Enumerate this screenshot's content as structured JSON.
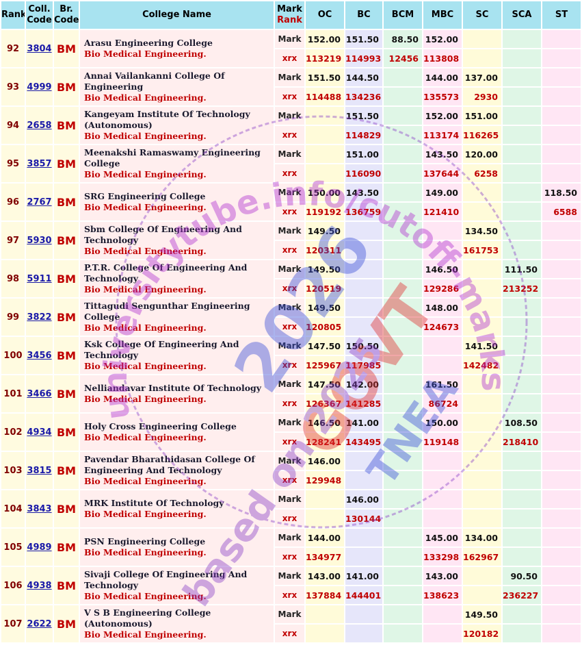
{
  "headers": {
    "rank": "Rank",
    "coll_code": "Coll. Code",
    "br_code": "Br. Code",
    "college_name": "College Name",
    "mark_word": "Mark",
    "rank_word": "Rank",
    "oc": "OC",
    "bc": "BC",
    "bcm": "BCM",
    "mbc": "MBC",
    "sc": "SC",
    "sca": "SCA",
    "st": "ST"
  },
  "labels": {
    "mark": "Mark",
    "rank": "xrx"
  },
  "watermark": {
    "line1": "universitytube.info/cutoff-marks",
    "line2": "2026",
    "line3": "GOVT",
    "line4": "TNEA",
    "line5": "based on 2025"
  },
  "colors": {
    "header_bg": "#a8e3f0",
    "rank_text": "#800000",
    "branch_text": "#c00000",
    "link_text": "#1a1aa8"
  },
  "rows": [
    {
      "rank": "92",
      "code": "3804",
      "br": "BM",
      "name": "Arasu Engineering College",
      "branch": "Bio Medical Engineering.",
      "marks": {
        "oc": "152.00",
        "bc": "151.50",
        "bcm": "88.50",
        "mbc": "152.00",
        "sc": "",
        "sca": "",
        "st": ""
      },
      "ranks": {
        "oc": "113219",
        "bc": "114993",
        "bcm": "12456",
        "mbc": "113808",
        "sc": "",
        "sca": "",
        "st": ""
      }
    },
    {
      "rank": "93",
      "code": "4999",
      "br": "BM",
      "name": "Annai Vailankanni College Of Engineering",
      "branch": "Bio Medical Engineering.",
      "marks": {
        "oc": "151.50",
        "bc": "144.50",
        "bcm": "",
        "mbc": "144.00",
        "sc": "137.00",
        "sca": "",
        "st": ""
      },
      "ranks": {
        "oc": "114488",
        "bc": "134236",
        "bcm": "",
        "mbc": "135573",
        "sc": "2930",
        "sca": "",
        "st": ""
      }
    },
    {
      "rank": "94",
      "code": "2658",
      "br": "BM",
      "name": "Kangeyam Institute Of Technology (Autonomous)",
      "branch": "Bio Medical Engineering.",
      "marks": {
        "oc": "",
        "bc": "151.50",
        "bcm": "",
        "mbc": "152.00",
        "sc": "151.00",
        "sca": "",
        "st": ""
      },
      "ranks": {
        "oc": "",
        "bc": "114829",
        "bcm": "",
        "mbc": "113174",
        "sc": "116265",
        "sca": "",
        "st": ""
      }
    },
    {
      "rank": "95",
      "code": "3857",
      "br": "BM",
      "name": "Meenakshi Ramaswamy Engineering College",
      "branch": "Bio Medical Engineering.",
      "marks": {
        "oc": "",
        "bc": "151.00",
        "bcm": "",
        "mbc": "143.50",
        "sc": "120.00",
        "sca": "",
        "st": ""
      },
      "ranks": {
        "oc": "",
        "bc": "116090",
        "bcm": "",
        "mbc": "137644",
        "sc": "6258",
        "sca": "",
        "st": ""
      }
    },
    {
      "rank": "96",
      "code": "2767",
      "br": "BM",
      "name": "SRG Engineering College",
      "branch": "Bio Medical Engineering.",
      "marks": {
        "oc": "150.00",
        "bc": "143.50",
        "bcm": "",
        "mbc": "149.00",
        "sc": "",
        "sca": "",
        "st": "118.50"
      },
      "ranks": {
        "oc": "119192",
        "bc": "136759",
        "bcm": "",
        "mbc": "121410",
        "sc": "",
        "sca": "",
        "st": "6588"
      }
    },
    {
      "rank": "97",
      "code": "5930",
      "br": "BM",
      "name": "Sbm College Of Engineering And Technology",
      "branch": "Bio Medical Engineering.",
      "marks": {
        "oc": "149.50",
        "bc": "",
        "bcm": "",
        "mbc": "",
        "sc": "134.50",
        "sca": "",
        "st": ""
      },
      "ranks": {
        "oc": "120311",
        "bc": "",
        "bcm": "",
        "mbc": "",
        "sc": "161753",
        "sca": "",
        "st": ""
      }
    },
    {
      "rank": "98",
      "code": "5911",
      "br": "BM",
      "name": "P.T.R. College Of Engineering And Technology",
      "branch": "Bio Medical Engineering.",
      "marks": {
        "oc": "149.50",
        "bc": "",
        "bcm": "",
        "mbc": "146.50",
        "sc": "",
        "sca": "111.50",
        "st": ""
      },
      "ranks": {
        "oc": "120519",
        "bc": "",
        "bcm": "",
        "mbc": "129286",
        "sc": "",
        "sca": "213252",
        "st": ""
      }
    },
    {
      "rank": "99",
      "code": "3822",
      "br": "BM",
      "name": "Tittagudi Sengunthar Engineering College",
      "branch": "Bio Medical Engineering.",
      "marks": {
        "oc": "149.50",
        "bc": "",
        "bcm": "",
        "mbc": "148.00",
        "sc": "",
        "sca": "",
        "st": ""
      },
      "ranks": {
        "oc": "120805",
        "bc": "",
        "bcm": "",
        "mbc": "124673",
        "sc": "",
        "sca": "",
        "st": ""
      }
    },
    {
      "rank": "100",
      "code": "3456",
      "br": "BM",
      "name": "Ksk College Of Engineering And Technology",
      "branch": "Bio Medical Engineering.",
      "marks": {
        "oc": "147.50",
        "bc": "150.50",
        "bcm": "",
        "mbc": "",
        "sc": "141.50",
        "sca": "",
        "st": ""
      },
      "ranks": {
        "oc": "125967",
        "bc": "117985",
        "bcm": "",
        "mbc": "",
        "sc": "142482",
        "sca": "",
        "st": ""
      }
    },
    {
      "rank": "101",
      "code": "3466",
      "br": "BM",
      "name": "Nelliandavar Institute Of Technology",
      "branch": "Bio Medical Engineering.",
      "marks": {
        "oc": "147.50",
        "bc": "142.00",
        "bcm": "",
        "mbc": "161.50",
        "sc": "",
        "sca": "",
        "st": ""
      },
      "ranks": {
        "oc": "126367",
        "bc": "141285",
        "bcm": "",
        "mbc": "86724",
        "sc": "",
        "sca": "",
        "st": ""
      }
    },
    {
      "rank": "102",
      "code": "4934",
      "br": "BM",
      "name": "Holy Cross Engineering College",
      "branch": "Bio Medical Engineering.",
      "marks": {
        "oc": "146.50",
        "bc": "141.00",
        "bcm": "",
        "mbc": "150.00",
        "sc": "",
        "sca": "108.50",
        "st": ""
      },
      "ranks": {
        "oc": "128241",
        "bc": "143495",
        "bcm": "",
        "mbc": "119148",
        "sc": "",
        "sca": "218410",
        "st": ""
      }
    },
    {
      "rank": "103",
      "code": "3815",
      "br": "BM",
      "name": "Pavendar Bharathidasan College Of Engineering And Technology",
      "branch": "Bio Medical Engineering.",
      "marks": {
        "oc": "146.00",
        "bc": "",
        "bcm": "",
        "mbc": "",
        "sc": "",
        "sca": "",
        "st": ""
      },
      "ranks": {
        "oc": "129948",
        "bc": "",
        "bcm": "",
        "mbc": "",
        "sc": "",
        "sca": "",
        "st": ""
      }
    },
    {
      "rank": "104",
      "code": "3843",
      "br": "BM",
      "name": "MRK Institute Of Technology",
      "branch": "Bio Medical Engineering.",
      "marks": {
        "oc": "",
        "bc": "146.00",
        "bcm": "",
        "mbc": "",
        "sc": "",
        "sca": "",
        "st": ""
      },
      "ranks": {
        "oc": "",
        "bc": "130144",
        "bcm": "",
        "mbc": "",
        "sc": "",
        "sca": "",
        "st": ""
      }
    },
    {
      "rank": "105",
      "code": "4989",
      "br": "BM",
      "name": "PSN Engineering College",
      "branch": "Bio Medical Engineering.",
      "marks": {
        "oc": "144.00",
        "bc": "",
        "bcm": "",
        "mbc": "145.00",
        "sc": "134.00",
        "sca": "",
        "st": ""
      },
      "ranks": {
        "oc": "134977",
        "bc": "",
        "bcm": "",
        "mbc": "133298",
        "sc": "162967",
        "sca": "",
        "st": ""
      }
    },
    {
      "rank": "106",
      "code": "4938",
      "br": "BM",
      "name": "Sivaji College Of Engineering And Technology",
      "branch": "Bio Medical Engineering.",
      "marks": {
        "oc": "143.00",
        "bc": "141.00",
        "bcm": "",
        "mbc": "143.00",
        "sc": "",
        "sca": "90.50",
        "st": ""
      },
      "ranks": {
        "oc": "137884",
        "bc": "144401",
        "bcm": "",
        "mbc": "138623",
        "sc": "",
        "sca": "236227",
        "st": ""
      }
    },
    {
      "rank": "107",
      "code": "2622",
      "br": "BM",
      "name": "V S B Engineering College (Autonomous)",
      "branch": "Bio Medical Engineering.",
      "marks": {
        "oc": "",
        "bc": "",
        "bcm": "",
        "mbc": "",
        "sc": "149.50",
        "sca": "",
        "st": ""
      },
      "ranks": {
        "oc": "",
        "bc": "",
        "bcm": "",
        "mbc": "",
        "sc": "120182",
        "sca": "",
        "st": ""
      }
    }
  ]
}
